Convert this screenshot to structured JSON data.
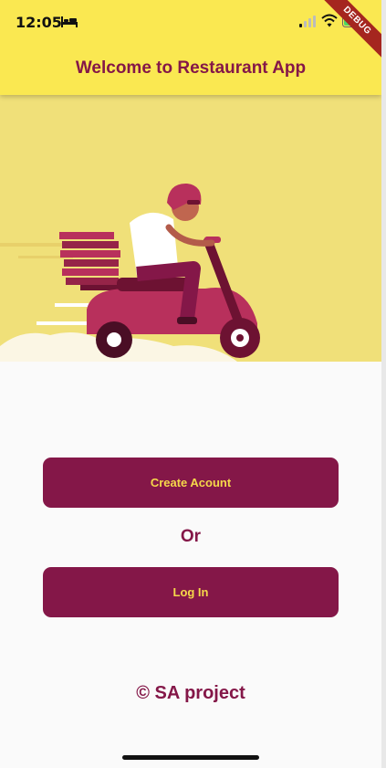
{
  "status_bar": {
    "time": "12:05",
    "debug_label": "DEBUG"
  },
  "app_bar": {
    "title": "Welcome to Restaurant App"
  },
  "actions": {
    "create_account_label": "Create Acount",
    "separator": "Or",
    "login_label": "Log In"
  },
  "footer": {
    "text": "© SA project"
  },
  "colors": {
    "app_bar_bg": "#fae851",
    "hero_bg": "#f0e079",
    "primary": "#841748",
    "button_text": "#f5d84a",
    "page_bg": "#fafafa"
  }
}
